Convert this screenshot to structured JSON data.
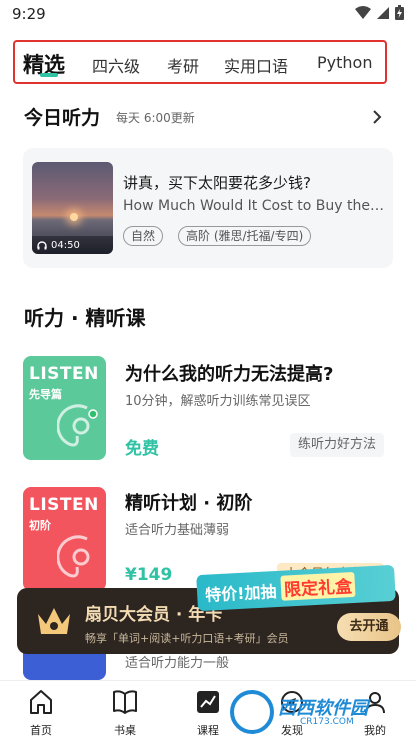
{
  "status": {
    "time": "9:29"
  },
  "tabs": [
    "精选",
    "四六级",
    "考研",
    "实用口语",
    "Python"
  ],
  "daily": {
    "title": "今日听力",
    "subtitle": "每天 6:00更新",
    "item_cn": "讲真，买下太阳要花多少钱?",
    "item_en": "How Much Would It Cost to Buy the Sun?",
    "duration": "04:50",
    "tags": [
      "自然",
      "高阶 (雅思/托福/专四)"
    ]
  },
  "section_title": "听力 · 精听课",
  "courses": [
    {
      "cover_word": "LISTEN",
      "cover_sub": "先导篇",
      "cover_color": "#5cc99a",
      "title": "为什么我的听力无法提高?",
      "desc": "10分钟，解惑听力训练常见误区",
      "price": "免费",
      "chip": "练听力好方法"
    },
    {
      "cover_word": "LISTEN",
      "cover_sub": "初阶",
      "cover_color": "#f2555e",
      "title": "精听计划 · 初阶",
      "desc": "适合听力基础薄弱",
      "price": "¥149",
      "chip": "上会员年卡免费"
    },
    {
      "cover_color": "#3c5fd6",
      "desc": "适合听力能力一般"
    }
  ],
  "promo": {
    "part1": "特价!加抽",
    "part2": "限定礼盒"
  },
  "member": {
    "title": "扇贝大会员 · 年卡",
    "desc": "畅享「单词+阅读+听力口语+考研」会员",
    "button": "去开通"
  },
  "bottom_nav": [
    "首页",
    "书桌",
    "课程",
    "发现",
    "我的"
  ],
  "watermark": {
    "text": "西西软件园",
    "domain": "CR173.COM"
  },
  "colors": {
    "accent": "#2fc2a4",
    "highlight_box": "#e0322e"
  }
}
